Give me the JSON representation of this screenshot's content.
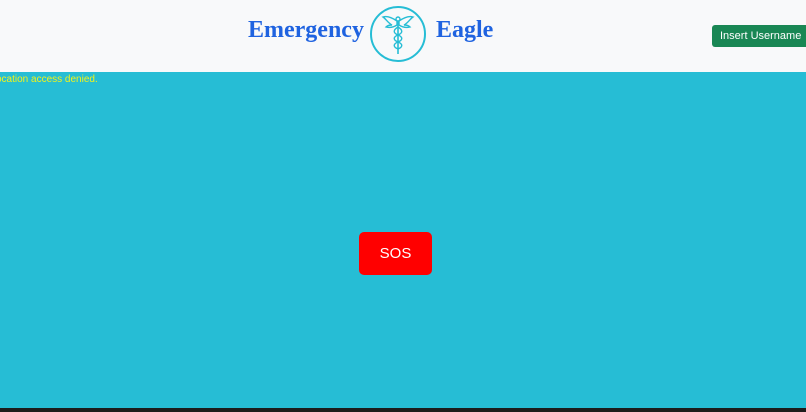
{
  "header": {
    "brand_left": "Emergency",
    "brand_right": "Eagle",
    "logo_icon": "caduceus-eagle-icon",
    "user_menu_label": "Insert Username"
  },
  "status": {
    "location_message": "ocation access denied."
  },
  "main": {
    "sos_label": "SOS"
  },
  "colors": {
    "page_background": "#26bdd5",
    "navbar_background": "#f8f9fa",
    "brand_text": "#1f63e0",
    "user_button": "#198754",
    "sos_button": "#ff0000",
    "status_text": "#f3f31a"
  }
}
